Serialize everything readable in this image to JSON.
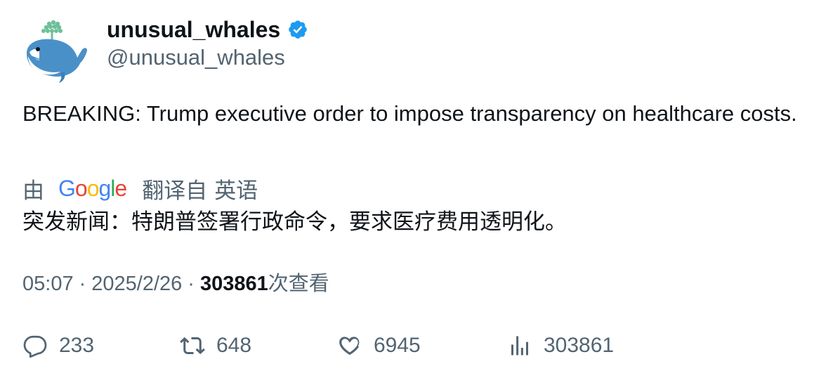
{
  "author": {
    "display_name": "unusual_whales",
    "handle": "@unusual_whales",
    "verified_color": "#1d9bf0"
  },
  "tweet": {
    "text": "BREAKING: Trump executive order to impose transparency on healthcare costs."
  },
  "translation": {
    "by_label": "由",
    "provider": "Google",
    "from_label": "翻译自",
    "language": "英语",
    "text": "突发新闻：特朗普签署行政命令，要求医疗费用透明化。"
  },
  "meta": {
    "time": "05:07",
    "separator": "·",
    "date": "2025/2/26",
    "views_count": "303861",
    "views_label": "次查看"
  },
  "actions": {
    "reply": {
      "icon": "reply-icon",
      "count": "233"
    },
    "retweet": {
      "icon": "retweet-icon",
      "count": "648"
    },
    "like": {
      "icon": "like-icon",
      "count": "6945"
    },
    "views": {
      "icon": "views-icon",
      "count": "303861"
    }
  },
  "colors": {
    "text": "#0f1419",
    "secondary": "#536471",
    "accent": "#1d9bf0"
  }
}
